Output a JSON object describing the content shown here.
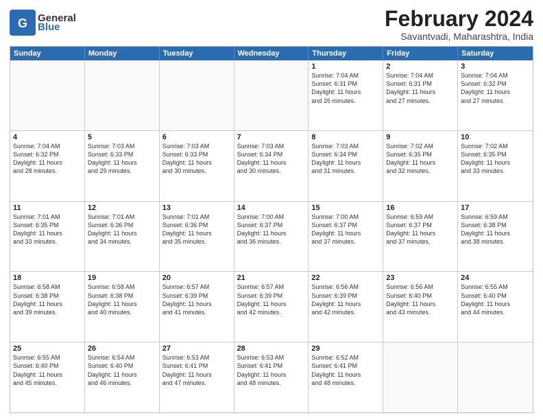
{
  "logo": {
    "general": "General",
    "blue": "Blue"
  },
  "title": "February 2024",
  "subtitle": "Savantvadi, Maharashtra, India",
  "header_days": [
    "Sunday",
    "Monday",
    "Tuesday",
    "Wednesday",
    "Thursday",
    "Friday",
    "Saturday"
  ],
  "weeks": [
    [
      {
        "day": "",
        "empty": true
      },
      {
        "day": "",
        "empty": true
      },
      {
        "day": "",
        "empty": true
      },
      {
        "day": "",
        "empty": true
      },
      {
        "day": "1",
        "info": "Sunrise: 7:04 AM\nSunset: 6:31 PM\nDaylight: 11 hours\nand 26 minutes."
      },
      {
        "day": "2",
        "info": "Sunrise: 7:04 AM\nSunset: 6:31 PM\nDaylight: 11 hours\nand 27 minutes."
      },
      {
        "day": "3",
        "info": "Sunrise: 7:04 AM\nSunset: 6:32 PM\nDaylight: 11 hours\nand 27 minutes."
      }
    ],
    [
      {
        "day": "4",
        "info": "Sunrise: 7:04 AM\nSunset: 6:32 PM\nDaylight: 11 hours\nand 28 minutes."
      },
      {
        "day": "5",
        "info": "Sunrise: 7:03 AM\nSunset: 6:33 PM\nDaylight: 11 hours\nand 29 minutes."
      },
      {
        "day": "6",
        "info": "Sunrise: 7:03 AM\nSunset: 6:33 PM\nDaylight: 11 hours\nand 30 minutes."
      },
      {
        "day": "7",
        "info": "Sunrise: 7:03 AM\nSunset: 6:34 PM\nDaylight: 11 hours\nand 30 minutes."
      },
      {
        "day": "8",
        "info": "Sunrise: 7:03 AM\nSunset: 6:34 PM\nDaylight: 11 hours\nand 31 minutes."
      },
      {
        "day": "9",
        "info": "Sunrise: 7:02 AM\nSunset: 6:35 PM\nDaylight: 11 hours\nand 32 minutes."
      },
      {
        "day": "10",
        "info": "Sunrise: 7:02 AM\nSunset: 6:35 PM\nDaylight: 11 hours\nand 33 minutes."
      }
    ],
    [
      {
        "day": "11",
        "info": "Sunrise: 7:01 AM\nSunset: 6:35 PM\nDaylight: 11 hours\nand 33 minutes."
      },
      {
        "day": "12",
        "info": "Sunrise: 7:01 AM\nSunset: 6:36 PM\nDaylight: 11 hours\nand 34 minutes."
      },
      {
        "day": "13",
        "info": "Sunrise: 7:01 AM\nSunset: 6:36 PM\nDaylight: 11 hours\nand 35 minutes."
      },
      {
        "day": "14",
        "info": "Sunrise: 7:00 AM\nSunset: 6:37 PM\nDaylight: 11 hours\nand 36 minutes."
      },
      {
        "day": "15",
        "info": "Sunrise: 7:00 AM\nSunset: 6:37 PM\nDaylight: 11 hours\nand 37 minutes."
      },
      {
        "day": "16",
        "info": "Sunrise: 6:59 AM\nSunset: 6:37 PM\nDaylight: 11 hours\nand 37 minutes."
      },
      {
        "day": "17",
        "info": "Sunrise: 6:59 AM\nSunset: 6:38 PM\nDaylight: 11 hours\nand 38 minutes."
      }
    ],
    [
      {
        "day": "18",
        "info": "Sunrise: 6:58 AM\nSunset: 6:38 PM\nDaylight: 11 hours\nand 39 minutes."
      },
      {
        "day": "19",
        "info": "Sunrise: 6:58 AM\nSunset: 6:38 PM\nDaylight: 11 hours\nand 40 minutes."
      },
      {
        "day": "20",
        "info": "Sunrise: 6:57 AM\nSunset: 6:39 PM\nDaylight: 11 hours\nand 41 minutes."
      },
      {
        "day": "21",
        "info": "Sunrise: 6:57 AM\nSunset: 6:39 PM\nDaylight: 11 hours\nand 42 minutes."
      },
      {
        "day": "22",
        "info": "Sunrise: 6:56 AM\nSunset: 6:39 PM\nDaylight: 11 hours\nand 42 minutes."
      },
      {
        "day": "23",
        "info": "Sunrise: 6:56 AM\nSunset: 6:40 PM\nDaylight: 11 hours\nand 43 minutes."
      },
      {
        "day": "24",
        "info": "Sunrise: 6:55 AM\nSunset: 6:40 PM\nDaylight: 11 hours\nand 44 minutes."
      }
    ],
    [
      {
        "day": "25",
        "info": "Sunrise: 6:55 AM\nSunset: 6:40 PM\nDaylight: 11 hours\nand 45 minutes."
      },
      {
        "day": "26",
        "info": "Sunrise: 6:54 AM\nSunset: 6:40 PM\nDaylight: 11 hours\nand 46 minutes."
      },
      {
        "day": "27",
        "info": "Sunrise: 6:53 AM\nSunset: 6:41 PM\nDaylight: 11 hours\nand 47 minutes."
      },
      {
        "day": "28",
        "info": "Sunrise: 6:53 AM\nSunset: 6:41 PM\nDaylight: 11 hours\nand 48 minutes."
      },
      {
        "day": "29",
        "info": "Sunrise: 6:52 AM\nSunset: 6:41 PM\nDaylight: 11 hours\nand 48 minutes."
      },
      {
        "day": "",
        "empty": true
      },
      {
        "day": "",
        "empty": true
      }
    ]
  ]
}
